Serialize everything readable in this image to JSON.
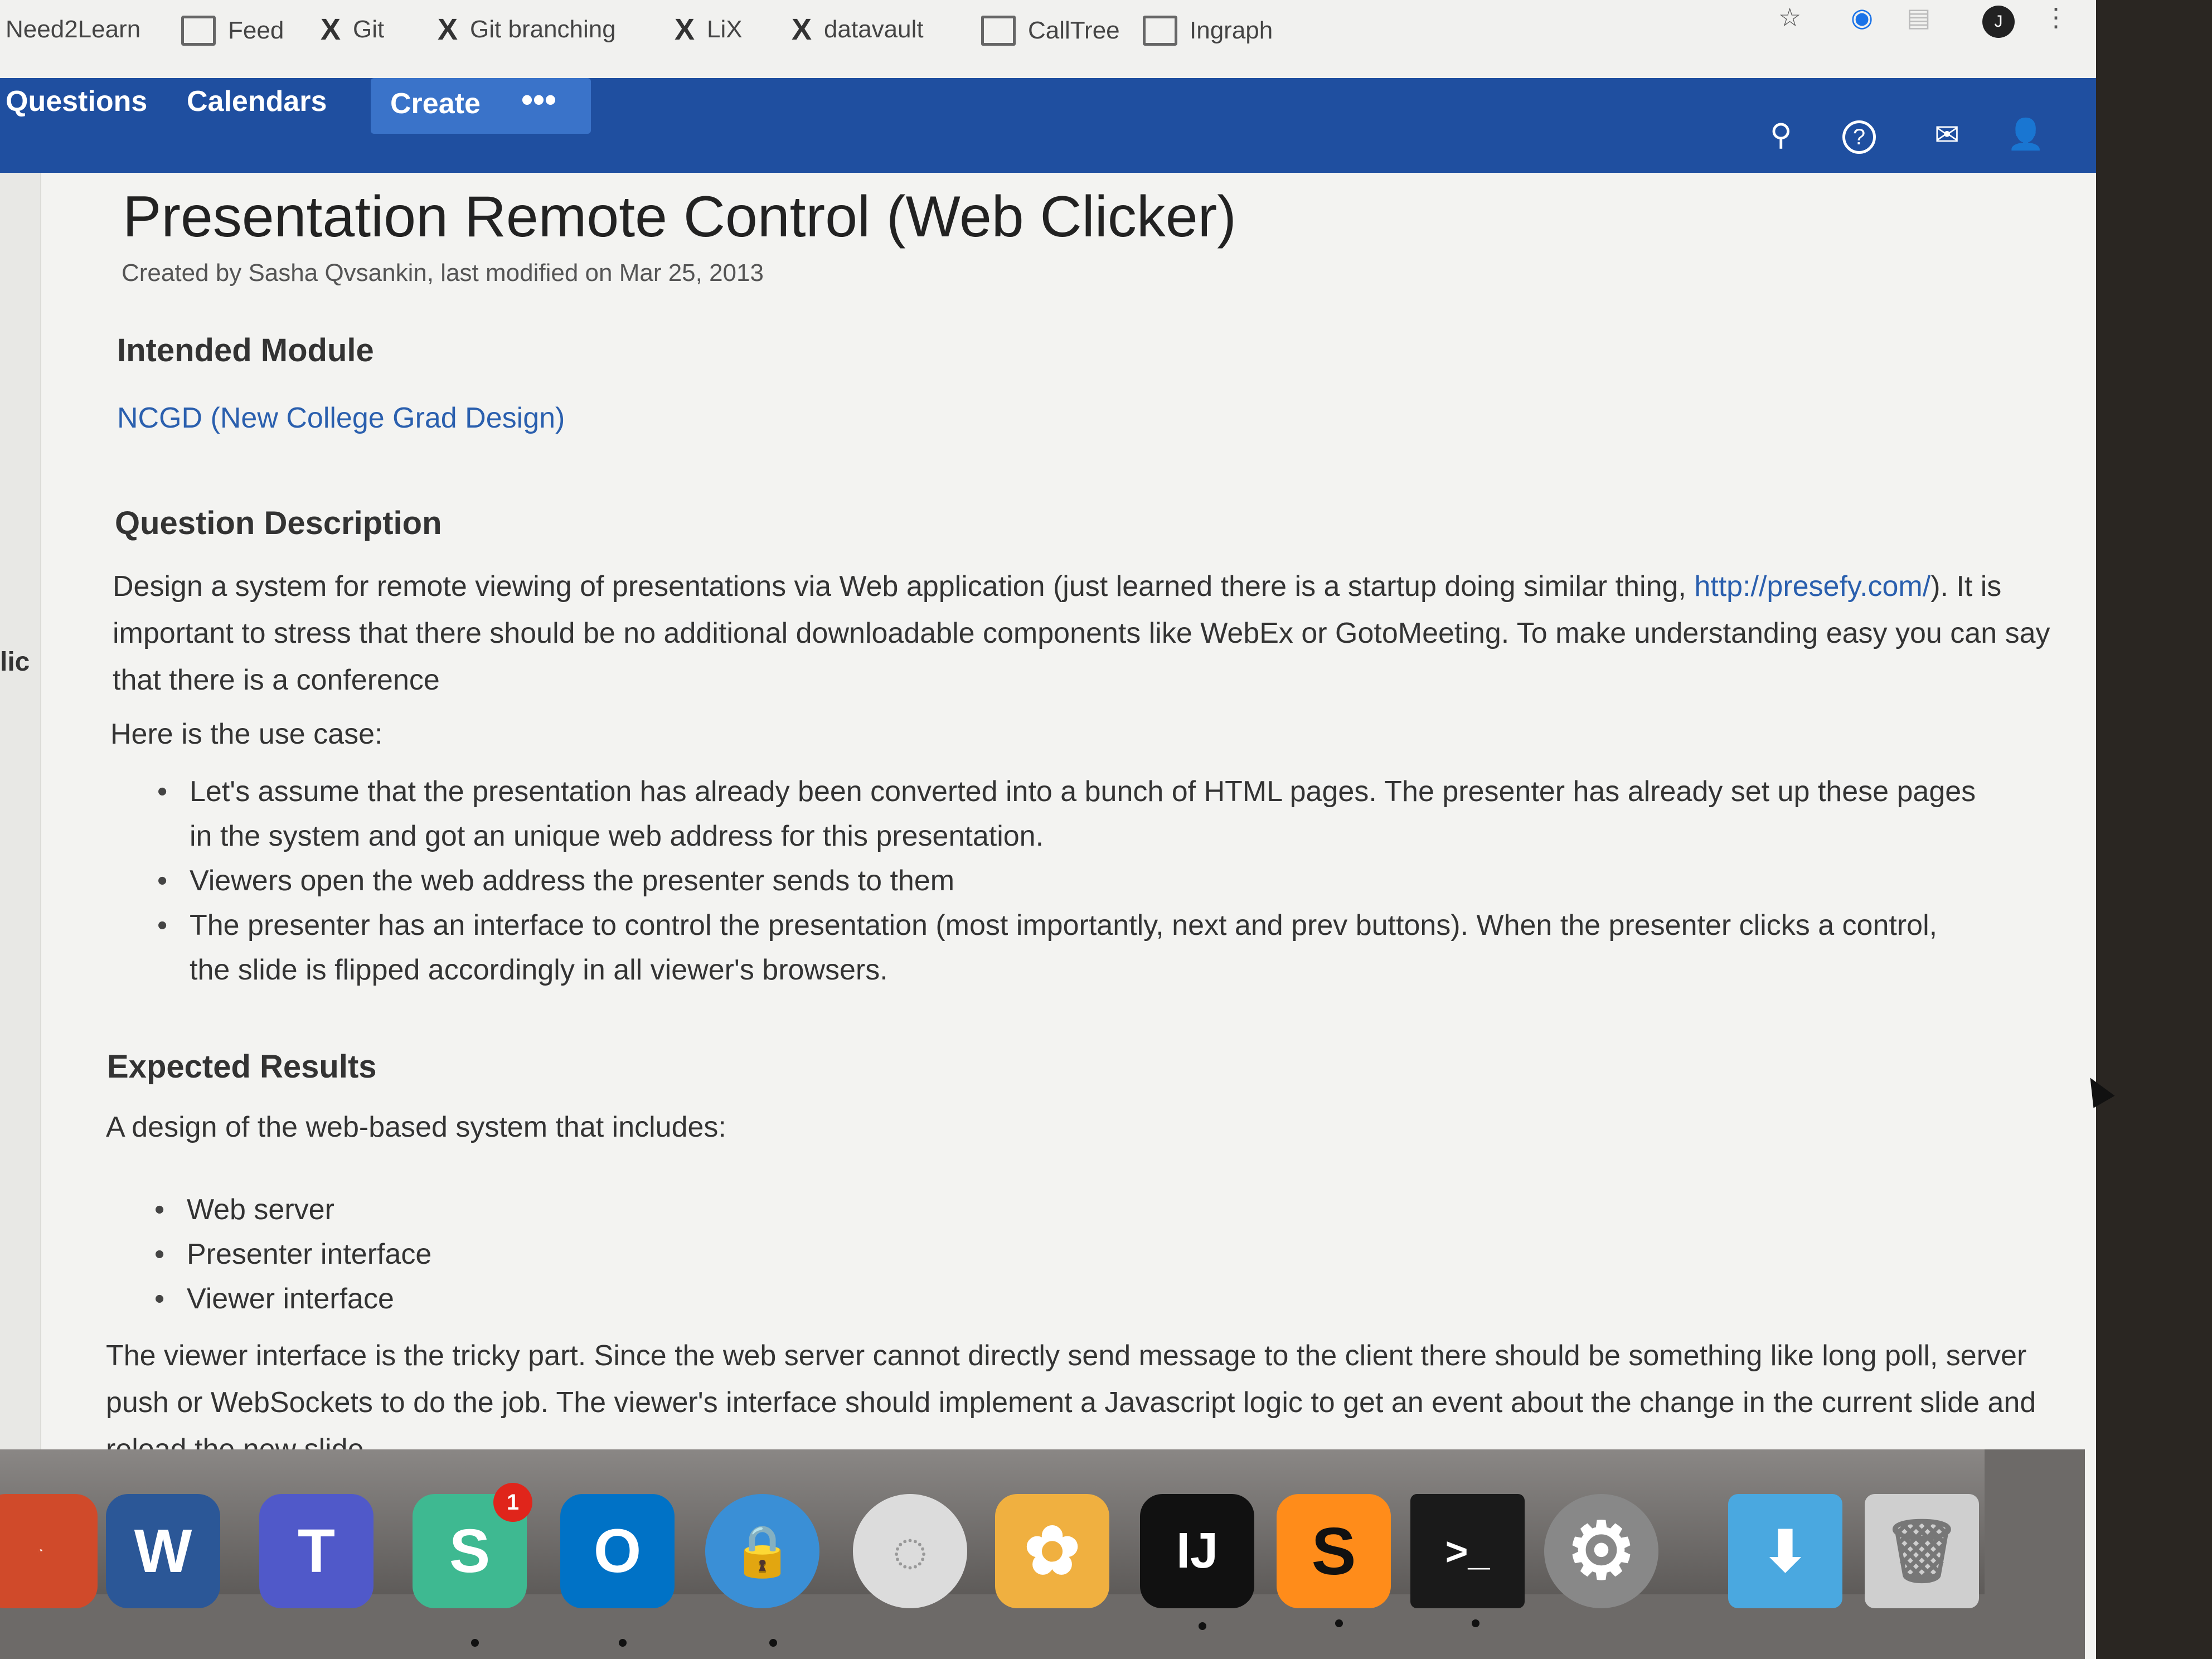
{
  "bookmarks": [
    {
      "label": "Need2Learn",
      "icon": "none"
    },
    {
      "label": "Feed",
      "icon": "folder-icon"
    },
    {
      "label": "Git",
      "icon": "x-icon"
    },
    {
      "label": "Git branching",
      "icon": "x-icon"
    },
    {
      "label": "LiX",
      "icon": "x-icon"
    },
    {
      "label": "datavault",
      "icon": "x-icon"
    },
    {
      "label": "CallTree",
      "icon": "page-icon"
    },
    {
      "label": "Ingraph",
      "icon": "folder-icon"
    }
  ],
  "browser_icons": {
    "star": "☆",
    "avatar": "J",
    "menu": "⋮"
  },
  "nav": {
    "questions": "Questions",
    "calendars": "Calendars",
    "create": "Create",
    "more": "•••",
    "search_icon": "⚲",
    "help_icon": "?",
    "user_icon": "👤"
  },
  "page": {
    "title": "Presentation Remote Control (Web Clicker)",
    "byline": "Created by Sasha Qvsankin, last modified on Mar 25, 2013",
    "intended_heading": "Intended Module",
    "module_link": "NCGD (New College Grad Design)",
    "question_heading": "Question Description",
    "desc_1": "Design a system for remote viewing of presentations via Web application (just learned there is a startup doing similar thing, ",
    "desc_link": "http://presefy.com/",
    "desc_2": "). It is important to stress that  there should be no additional downloadable components like WebEx or GotoMeeting. To make understanding easy you can say that there is a conference",
    "use_case_intro": "Here is the use case:",
    "use_cases": [
      "Let's assume that the presentation has already been converted into a bunch of HTML pages. The presenter has already set up these pages in the system and got an unique web address for this presentation.",
      "Viewers open the web address the presenter sends to them",
      "The presenter has an interface to control the presentation (most importantly, next and prev buttons). When the presenter clicks a control, the slide is flipped accordingly in all viewer's browsers."
    ],
    "expected_heading": "Expected Results",
    "expected_intro": "A design of the web-based system that includes:",
    "expected_items": [
      "Web server",
      "Presenter interface",
      "Viewer interface"
    ],
    "tricky": "The viewer interface is the tricky part. Since the web server cannot directly send message to the client there should be something like long poll, server push or WebSockets to do the job. The viewer's interface should implement a Javascript logic to get an event about the change in the current slide and reload the new slide."
  },
  "side_fragment": "lic",
  "dock_apps": [
    {
      "name": "word-icon",
      "glyph": "W",
      "color": "#2b5797"
    },
    {
      "name": "teams-icon",
      "glyph": "T",
      "color": "#5059c9"
    },
    {
      "name": "slack-icon",
      "glyph": "S",
      "color": "#3eb991"
    },
    {
      "name": "outlook-icon",
      "glyph": "O",
      "color": "#0072c6"
    },
    {
      "name": "vpn-icon",
      "glyph": "🔒",
      "color": "#3a8fd6"
    },
    {
      "name": "wifi-icon",
      "glyph": "◌",
      "color": "#dcdcdc"
    },
    {
      "name": "photos-icon",
      "glyph": "✿",
      "color": "#f0b040"
    },
    {
      "name": "intellij-icon",
      "glyph": "IJ",
      "color": "#111111"
    },
    {
      "name": "sublime-icon",
      "glyph": "S",
      "color": "#ff8c1a"
    },
    {
      "name": "terminal-icon",
      "glyph": ">_",
      "color": "#1a1a1a"
    },
    {
      "name": "settings-icon",
      "glyph": "⚙",
      "color": "#888888"
    },
    {
      "name": "downloads-folder-icon",
      "glyph": "⬇",
      "color": "#4aa8e0"
    },
    {
      "name": "trash-icon",
      "glyph": "🗑",
      "color": "#cfcfcf"
    }
  ],
  "slack_badge": "1"
}
